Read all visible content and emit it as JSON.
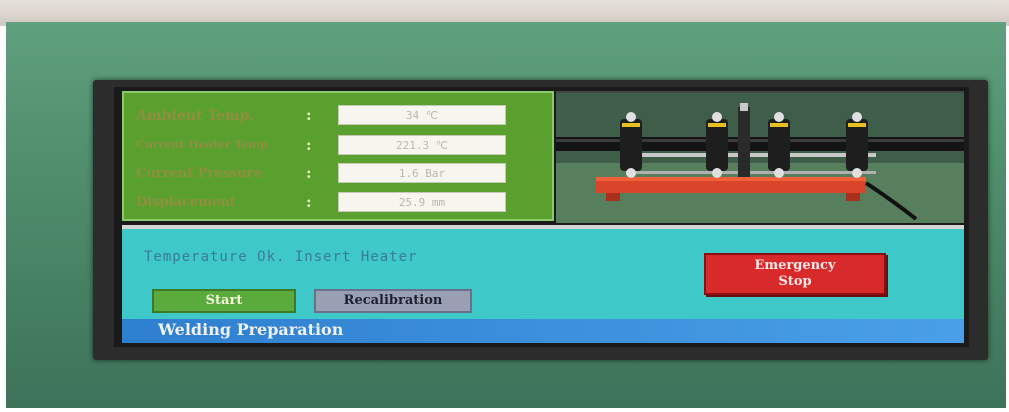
{
  "readings": [
    {
      "label": "Ambient Temp.",
      "colon": ":",
      "value": "34 ℃"
    },
    {
      "label": "Current Heater Temp",
      "colon": ":",
      "value": "221.3 ℃"
    },
    {
      "label": "Current Pressure",
      "colon": ":",
      "value": "1.6 Bar"
    },
    {
      "label": "Displacement",
      "colon": ":",
      "value": "25.9 mm"
    }
  ],
  "status": {
    "message": "Temperature Ok. Insert Heater"
  },
  "buttons": {
    "start": "Start",
    "recalibration": "Recalibration",
    "emergency_line1": "Emergency",
    "emergency_line2": "Stop"
  },
  "footer": {
    "title": "Welding Preparation"
  },
  "photo": {
    "subject": "butt-fusion-welding-machine-image"
  },
  "colors": {
    "readings_panel": "#5aa02f",
    "status_area": "#3ec8c8",
    "start_button": "#5aaa3c",
    "recalibration_button": "#9aa0b4",
    "emergency_button": "#d82a2a",
    "footer_bar": "#2e7fcf"
  }
}
